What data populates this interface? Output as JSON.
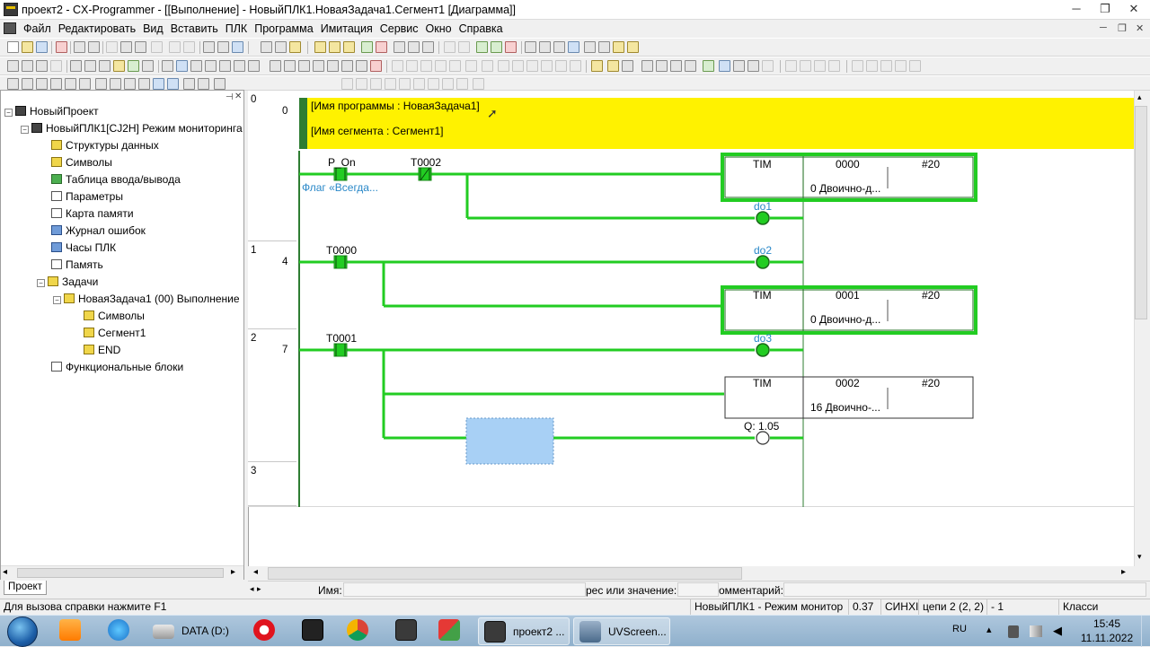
{
  "window": {
    "title": "проект2 - CX-Programmer - [[Выполнение] - НовыйПЛК1.НоваяЗадача1.Сегмент1 [Диаграмма]]",
    "min": "─",
    "restore": "❐",
    "close": "✕"
  },
  "menu": {
    "items": [
      "Файл",
      "Редактировать",
      "Вид",
      "Вставить",
      "ПЛК",
      "Программа",
      "Имитация",
      "Сервис",
      "Окно",
      "Справка"
    ]
  },
  "tree": {
    "nodes": [
      {
        "label": "НовыйПроект",
        "icon": "project-icon"
      },
      {
        "label": "НовыйПЛК1[CJ2H] Режим мониторинга",
        "icon": "plc-icon"
      },
      {
        "label": "Структуры данных",
        "icon": "data-structures-icon"
      },
      {
        "label": "Символы",
        "icon": "symbols-icon"
      },
      {
        "label": "Таблица ввода/вывода",
        "icon": "io-table-icon"
      },
      {
        "label": "Параметры",
        "icon": "settings-icon"
      },
      {
        "label": "Карта памяти",
        "icon": "memory-card-icon"
      },
      {
        "label": "Журнал ошибок",
        "icon": "error-log-icon"
      },
      {
        "label": "Часы ПЛК",
        "icon": "clock-icon"
      },
      {
        "label": "Память",
        "icon": "memory-icon"
      },
      {
        "label": "Задачи",
        "icon": "tasks-icon"
      },
      {
        "label": "НоваяЗадача1 (00) Выполнение",
        "icon": "task-icon"
      },
      {
        "label": "Символы",
        "icon": "local-symbols-icon"
      },
      {
        "label": "Сегмент1",
        "icon": "section-icon"
      },
      {
        "label": "END",
        "icon": "end-section-icon"
      },
      {
        "label": "Функциональные блоки",
        "icon": "function-blocks-icon"
      }
    ],
    "tab": "Проект"
  },
  "ladder": {
    "comment": {
      "program": "[Имя программы : НоваяЗадача1]",
      "section": "[Имя сегмента : Сегмент1]"
    },
    "rungs": [
      {
        "rung": "0",
        "step": "0"
      },
      {
        "rung": "1",
        "step": "4"
      },
      {
        "rung": "2",
        "step": "7"
      },
      {
        "rung": "3",
        "step": ""
      }
    ],
    "contacts": [
      {
        "name": "P_On",
        "comment": "Флаг «Всегда..."
      },
      {
        "name": "T0002"
      },
      {
        "name": "T0000"
      },
      {
        "name": "T0001"
      }
    ],
    "coils": [
      "do1",
      "do2",
      "do3",
      "Q: 1.05"
    ],
    "timers": [
      {
        "instr": "TIM",
        "num": "0000",
        "sv": "#20",
        "pv": "0 Двоично-д..."
      },
      {
        "instr": "TIM",
        "num": "0001",
        "sv": "#20",
        "pv": "0 Двоично-д..."
      },
      {
        "instr": "TIM",
        "num": "0002",
        "sv": "#20",
        "pv": "16 Двоично-..."
      }
    ]
  },
  "infobar": {
    "name_label": "Имя:",
    "address_label": "рес или значение:",
    "comment_label": "омментарий:"
  },
  "status": {
    "help": "Для вызова справки нажмите F1",
    "plc": "НовыйПЛК1 - Режим монитор",
    "cycle": "0.37",
    "sync": "СИНХІ",
    "rung": "цепи 2 (2, 2)",
    "one": "- 1",
    "view": "Класси"
  },
  "taskbar": {
    "apps": [
      {
        "label": "",
        "icon": "start-orb-icon"
      },
      {
        "label": "",
        "icon": "media-player-icon"
      },
      {
        "label": "",
        "icon": "internet-explorer-icon"
      },
      {
        "label": "DATA (D:)",
        "icon": "drive-icon"
      },
      {
        "label": "",
        "icon": "opera-icon"
      },
      {
        "label": "",
        "icon": "device-icon"
      },
      {
        "label": "",
        "icon": "chrome-icon"
      },
      {
        "label": "",
        "icon": "calculator-icon"
      },
      {
        "label": "",
        "icon": "app-icon"
      },
      {
        "label": "проект2 ...",
        "icon": "cx-programmer-icon"
      },
      {
        "label": "UVScreen...",
        "icon": "uvscreen-icon"
      }
    ],
    "lang": "RU",
    "time": "15:45",
    "date": "11.11.2022"
  }
}
